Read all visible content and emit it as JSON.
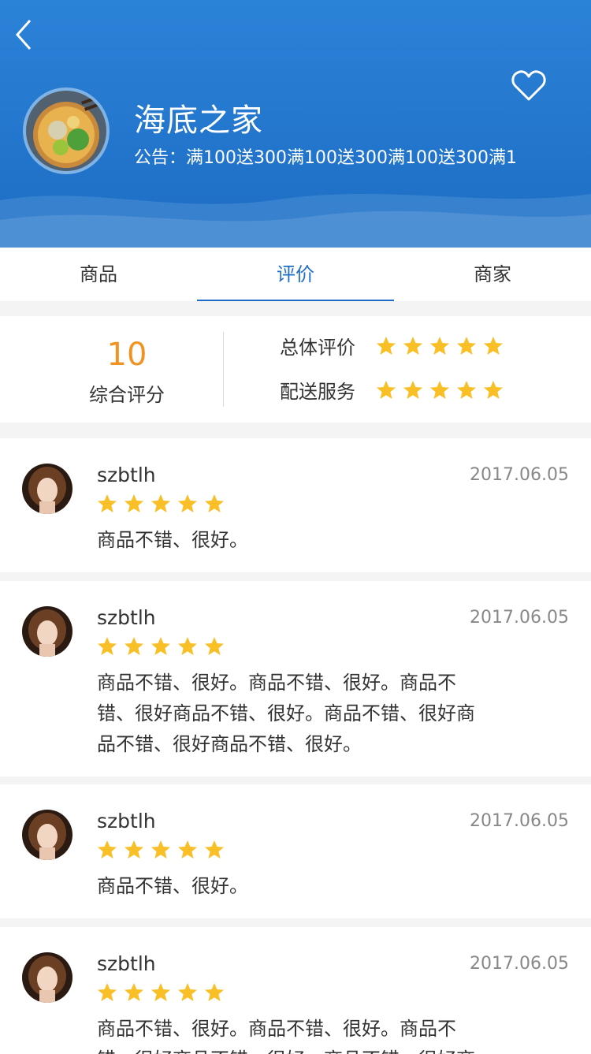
{
  "header": {
    "shop_name": "海底之家",
    "notice": "公告：满100送300满100送300满100送300满1"
  },
  "tabs": [
    "商品",
    "评价",
    "商家"
  ],
  "active_tab": 1,
  "summary": {
    "score": "10",
    "score_label": "综合评分",
    "overall_label": "总体评价",
    "delivery_label": "配送服务",
    "overall_stars": 5,
    "delivery_stars": 5
  },
  "reviews": [
    {
      "user": "szbtlh",
      "date": "2017.06.05",
      "stars": 5,
      "text": "商品不错、很好。"
    },
    {
      "user": "szbtlh",
      "date": "2017.06.05",
      "stars": 5,
      "text": "商品不错、很好。商品不错、很好。商品不错、很好商品不错、很好。商品不错、很好商品不错、很好商品不错、很好。"
    },
    {
      "user": "szbtlh",
      "date": "2017.06.05",
      "stars": 5,
      "text": "商品不错、很好。"
    },
    {
      "user": "szbtlh",
      "date": "2017.06.05",
      "stars": 5,
      "text": "商品不错、很好。商品不错、很好。商品不错、很好商品不错、很好。商品不错、很好商品不错、很好商品不错、很好。"
    }
  ],
  "colors": {
    "brand_blue": "#1f6fc6",
    "score_orange": "#f09322",
    "star_yellow": "#f8bf27"
  },
  "icons": {
    "back": "chevron-left-icon",
    "favorite": "heart-icon",
    "star": "star-icon"
  }
}
